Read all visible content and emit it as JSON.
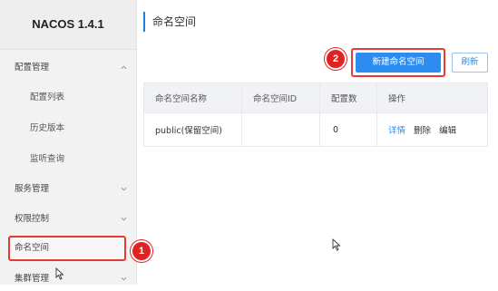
{
  "brand": "NACOS 1.4.1",
  "sidebar": {
    "items": [
      {
        "label": "配置管理"
      },
      {
        "label": "配置列表"
      },
      {
        "label": "历史版本"
      },
      {
        "label": "监听查询"
      },
      {
        "label": "服务管理"
      },
      {
        "label": "权限控制"
      },
      {
        "label": "命名空间"
      },
      {
        "label": "集群管理"
      }
    ]
  },
  "annotations": {
    "step1": "1",
    "step2": "2"
  },
  "main": {
    "title": "命名空间",
    "create_button": "新建命名空间",
    "refresh_button": "刷新",
    "table": {
      "headers": [
        "命名空间名称",
        "命名空间ID",
        "配置数",
        "操作"
      ],
      "rows": [
        {
          "name": "public(保留空间)",
          "id": "",
          "count": "0",
          "actions": {
            "detail": "详情",
            "delete": "删除",
            "edit": "编辑"
          }
        }
      ]
    }
  },
  "colors": {
    "accent": "#2d8cf0",
    "highlight": "#e53935"
  }
}
